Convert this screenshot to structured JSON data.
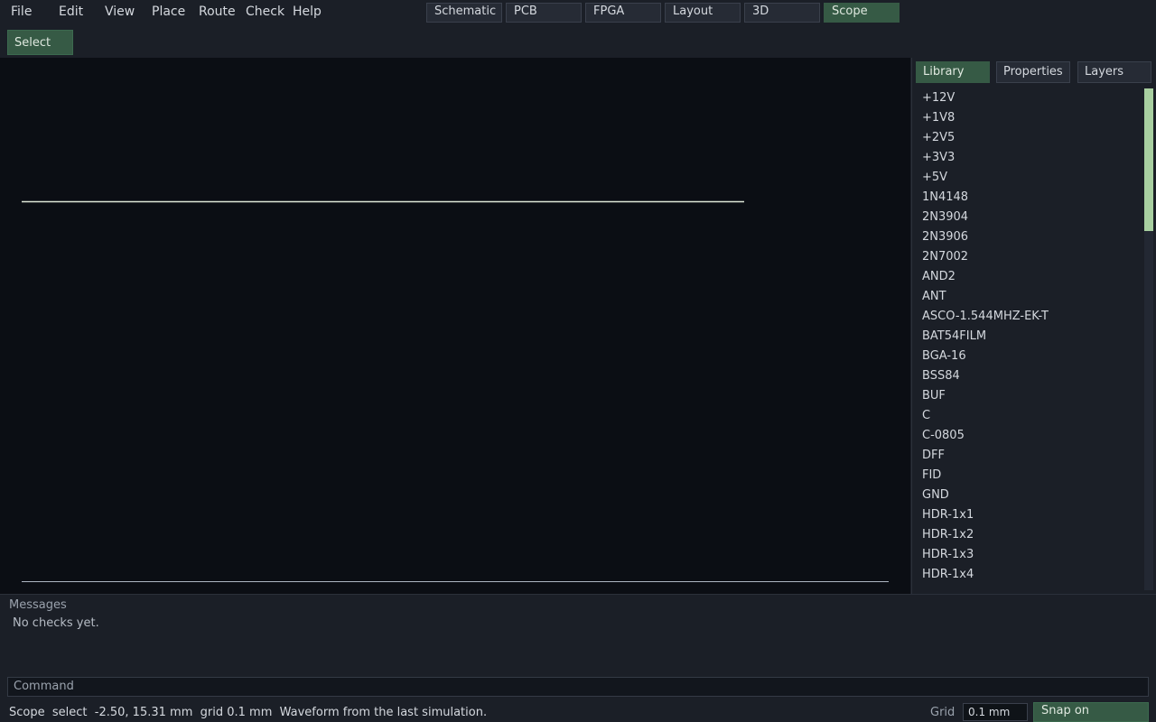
{
  "menu": [
    "File",
    "Edit",
    "View",
    "Place",
    "Route",
    "Check",
    "Help"
  ],
  "modes": {
    "items": [
      "Schematic",
      "PCB",
      "FPGA",
      "Layout",
      "3D",
      "Scope"
    ],
    "active": "Scope"
  },
  "toolbar": {
    "select_label": "Select"
  },
  "panel": {
    "tabs": [
      "Library",
      "Properties",
      "Layers"
    ],
    "active_tab": "Library",
    "library_items": [
      "+12V",
      "+1V8",
      "+2V5",
      "+3V3",
      "+5V",
      "1N4148",
      "2N3904",
      "2N3906",
      "2N7002",
      "AND2",
      "ANT",
      "ASCO-1.544MHZ-EK-T",
      "BAT54FILM",
      "BGA-16",
      "BSS84",
      "BUF",
      "C",
      "C-0805",
      "DFF",
      "FID",
      "GND",
      "HDR-1x1",
      "HDR-1x2",
      "HDR-1x3",
      "HDR-1x4"
    ]
  },
  "messages": {
    "title": "Messages",
    "body": "No checks yet."
  },
  "command": {
    "placeholder": "Command"
  },
  "status": {
    "mode": "Scope",
    "tool": "select",
    "coords": "-2.50, 15.31 mm",
    "grid": "grid 0.1 mm",
    "message": "Waveform from the last simulation.",
    "grid_label": "Grid",
    "grid_value": "0.1 mm",
    "snap_label": "Snap on"
  },
  "colors": {
    "accent": "#365a45",
    "waveform": "#dfe8d8",
    "canvas_bg": "#0b0e14",
    "scroll_thumb": "#a8cfa0"
  }
}
